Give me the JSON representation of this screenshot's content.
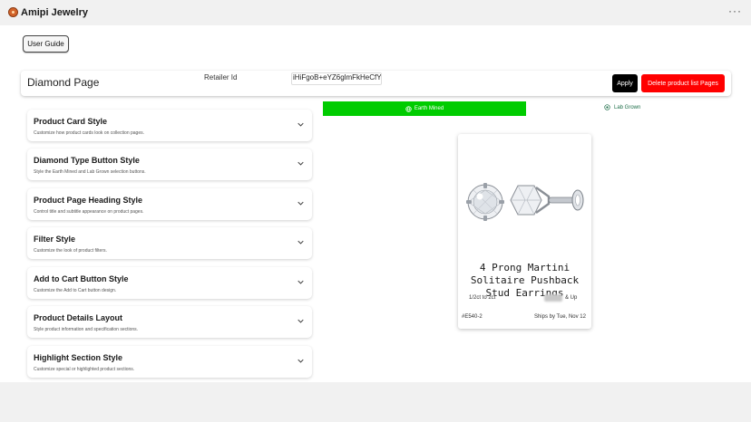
{
  "app": {
    "title": "Amipi Jewelry",
    "more_icon": "ellipsis-icon"
  },
  "toolbar": {
    "user_guide_label": "User Guide"
  },
  "header": {
    "page_title": "Diamond Page",
    "retailer_label": "Retailer Id",
    "retailer_value": "iHiFgoB+eYZ6glmFkHeCfY",
    "apply_label": "Apply",
    "delete_label": "Delete product list Pages"
  },
  "panels": [
    {
      "title": "Product Card Style",
      "description": "Customize how product cards look on collection pages."
    },
    {
      "title": "Diamond Type Button Style",
      "description": "Style the Earth Mined and Lab Grown selection buttons."
    },
    {
      "title": "Product Page Heading Style",
      "description": "Control title and subtitle appearance on product pages."
    },
    {
      "title": "Filter Style",
      "description": "Customize the look of product filters."
    },
    {
      "title": "Add to Cart Button Style",
      "description": "Customize the Add to Cart button design."
    },
    {
      "title": "Product Details Layout",
      "description": "Style product information and specification sections."
    },
    {
      "title": "Highlight Section Style",
      "description": "Customize special or highlighted product sections."
    }
  ],
  "diamond_type": {
    "earth_label": "Earth Mined",
    "lab_label": "Lab Grown",
    "colors": {
      "earth_bg": "#00cc00",
      "lab_text": "#1f6f4a"
    }
  },
  "product": {
    "name": "4 Prong Martini Solitaire Pushback Stud Earrings",
    "carat_range": "1/2ct to 2ct",
    "price_suffix": "& Up",
    "sku": "#E540-2",
    "shipping": "Ships by Tue, Nov 12"
  },
  "colors": {
    "apply_bg": "#000000",
    "delete_bg": "#ff0000"
  }
}
